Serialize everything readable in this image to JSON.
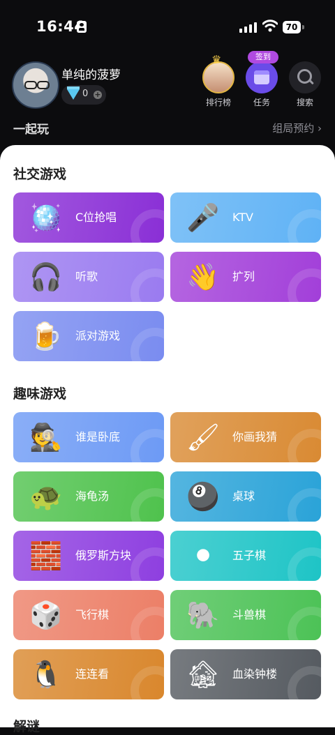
{
  "status_bar": {
    "time": "16:44",
    "battery": "70"
  },
  "header": {
    "username": "单纯的菠萝",
    "coins": "0",
    "buttons": [
      {
        "label": "排行榜",
        "icon": "crown-icon"
      },
      {
        "label": "任务",
        "icon": "calendar-icon",
        "badge": "签到"
      },
      {
        "label": "搜索",
        "icon": "search-icon"
      }
    ]
  },
  "section_header": {
    "title": "一起玩",
    "link": "组局预约 ›"
  },
  "social": {
    "title": "社交游戏",
    "cards": [
      {
        "label": "C位抢唱",
        "icon": "disco-ball-icon",
        "glyph": "🪩"
      },
      {
        "label": "KTV",
        "icon": "microphone-icon",
        "glyph": "🎤"
      },
      {
        "label": "听歌",
        "icon": "headphones-icon",
        "glyph": "🎧"
      },
      {
        "label": "扩列",
        "icon": "waving-hand-icon",
        "glyph": "👋"
      },
      {
        "label": "派对游戏",
        "icon": "beer-icon",
        "glyph": "🍺"
      }
    ]
  },
  "fun": {
    "title": "趣味游戏",
    "cards": [
      {
        "label": "谁是卧底",
        "icon": "spy-icon",
        "glyph": "🕵"
      },
      {
        "label": "你画我猜",
        "icon": "paintbrush-icon",
        "glyph": "🖌"
      },
      {
        "label": "海龟汤",
        "icon": "turtle-icon",
        "glyph": "🐢"
      },
      {
        "label": "桌球",
        "icon": "eight-ball-icon",
        "glyph": "🎱"
      },
      {
        "label": "俄罗斯方块",
        "icon": "tetris-block-icon",
        "glyph": "🧱"
      },
      {
        "label": "五子棋",
        "icon": "go-stones-icon",
        "glyph": "⚫"
      },
      {
        "label": "飞行棋",
        "icon": "dice-icon",
        "glyph": "🎲"
      },
      {
        "label": "斗兽棋",
        "icon": "animal-chess-icon",
        "glyph": "🐘"
      },
      {
        "label": "连连看",
        "icon": "penguin-icon",
        "glyph": "🐧"
      },
      {
        "label": "血染钟楼",
        "icon": "clock-tower-icon",
        "glyph": "🏚"
      }
    ]
  },
  "next_section": {
    "title": "解谜"
  },
  "colors": {
    "background": "#0c0c0e",
    "social_cards": [
      "#8a2fd6",
      "#5fb2f5",
      "#9a7bf0",
      "#a23fd9",
      "#7a8cf0"
    ],
    "fun_cards": [
      "#6d9af5",
      "#d98a33",
      "#4fc24d",
      "#2aa3d8",
      "#8e3fe0",
      "#1ec4c6",
      "#ec7f67",
      "#4cc256",
      "#d9872d",
      "#555a60"
    ]
  }
}
